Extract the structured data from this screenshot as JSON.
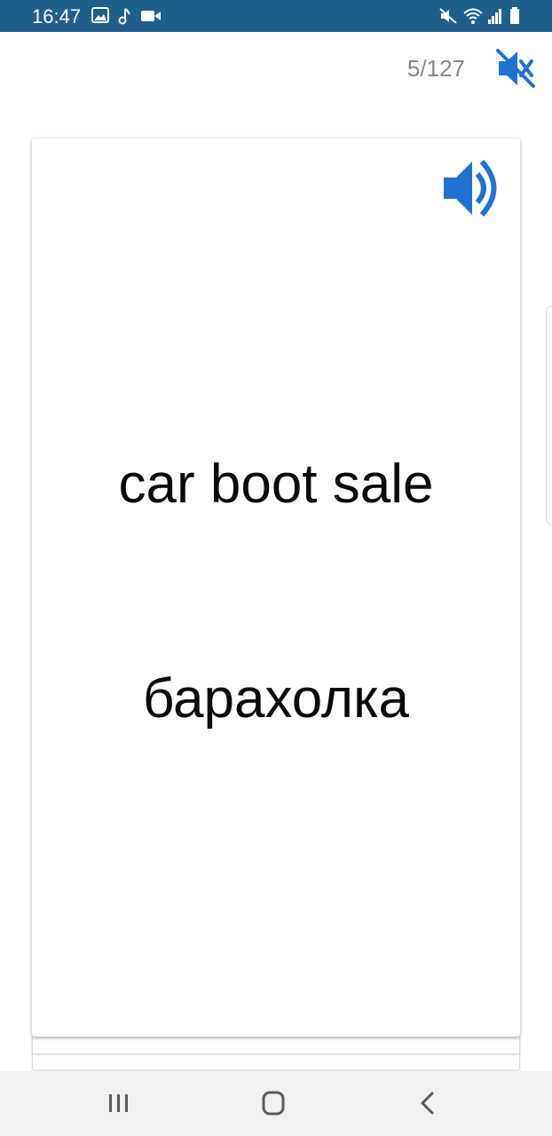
{
  "status_bar": {
    "time": "16:47",
    "left_icons": [
      "image-icon",
      "music-note-icon",
      "video-camera-icon"
    ],
    "right_icons": [
      "vibrate-mute-icon",
      "wifi-icon",
      "signal-icon",
      "battery-icon"
    ],
    "background": "#1f5f8b"
  },
  "header": {
    "counter": "5/127",
    "mute_icon": "speaker-muted-icon",
    "accent_color": "#1e73d2"
  },
  "card": {
    "speaker_icon": "speaker-icon",
    "front_text": "car boot sale",
    "back_text": "барахолка"
  },
  "nav_bar": {
    "buttons": [
      "recents-icon",
      "home-icon",
      "back-icon"
    ]
  }
}
